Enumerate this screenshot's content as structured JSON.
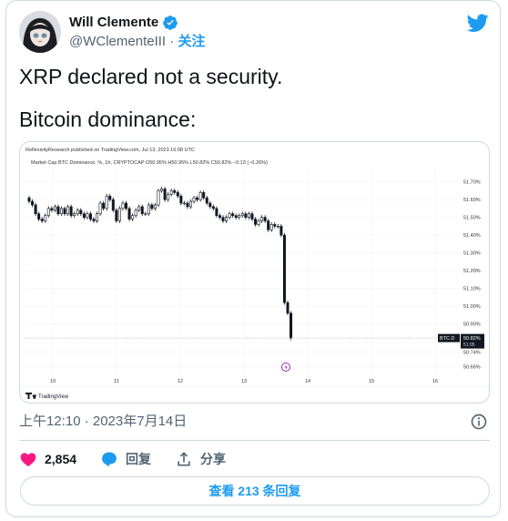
{
  "tweet": {
    "author_name": "Will Clemente",
    "handle": "@WClementeIII",
    "separator": " · ",
    "follow_label": "关注",
    "text_line1": "XRP declared not a security.",
    "text_line2": "Bitcoin dominance:",
    "timestamp": "上午12:10 · 2023年7月14日",
    "likes": "2,854",
    "reply_label": "回复",
    "share_label": "分享",
    "view_replies": "查看 213 条回复"
  },
  "colors": {
    "like": "#f91880",
    "reply": "#1d9bf0",
    "accent": "#1d9bf0",
    "verified": "#1d9bf0"
  },
  "icons": {
    "avatar": "avatar-image",
    "verified": "verified-badge-icon",
    "brand": "twitter-bird-icon",
    "info": "info-icon",
    "like": "heart-icon",
    "reply": "reply-bubble-icon",
    "share": "share-icon"
  },
  "chart_data": {
    "type": "candlestick",
    "header": "ReflexivityResearch published on TradingView.com, Jul 13, 2023 16:08 UTC",
    "legend": "Market Cap BTC Dominance, %, 1h, CRYPTOCAP O50.95% H50.95% L50.82% C50.82% −0.13 (−0.26%)",
    "x_ticks": [
      "10",
      "11",
      "12",
      "13",
      "14",
      "15",
      "16"
    ],
    "y_ticks": [
      "51.70%",
      "51.60%",
      "51.50%",
      "51.40%",
      "51.30%",
      "51.20%",
      "51.10%",
      "51.00%",
      "50.90%",
      "50.74%",
      "50.66%"
    ],
    "ylim": [
      50.6,
      51.77
    ],
    "last_label": "BTC.D",
    "last_value": "50.82%",
    "last_value_sub": "51:05",
    "last_y": 50.82,
    "watermark": "TradingView",
    "series": [
      {
        "name": "BTC.D",
        "close": [
          51.59,
          51.57,
          51.52,
          51.49,
          51.48,
          51.51,
          51.55,
          51.54,
          51.56,
          51.52,
          51.55,
          51.52,
          51.56,
          51.51,
          51.52,
          51.54,
          51.52,
          51.5,
          51.52,
          51.49,
          51.48,
          51.52,
          51.58,
          51.55,
          51.62,
          51.6,
          51.54,
          51.48,
          51.55,
          51.58,
          51.55,
          51.49,
          51.51,
          51.54,
          51.56,
          51.52,
          51.52,
          51.57,
          51.55,
          51.57,
          51.65,
          51.66,
          51.6,
          51.63,
          51.65,
          51.64,
          51.62,
          51.58,
          51.58,
          51.56,
          51.59,
          51.61,
          51.6,
          51.64,
          51.61,
          51.58,
          51.56,
          51.55,
          51.51,
          51.5,
          51.48,
          51.5,
          51.52,
          51.51,
          51.5,
          51.51,
          51.52,
          51.5,
          51.52,
          51.49,
          51.46,
          51.48,
          51.5,
          51.48,
          51.43,
          51.46,
          51.45,
          51.45,
          51.4,
          51.02,
          50.96,
          50.82
        ]
      }
    ]
  }
}
